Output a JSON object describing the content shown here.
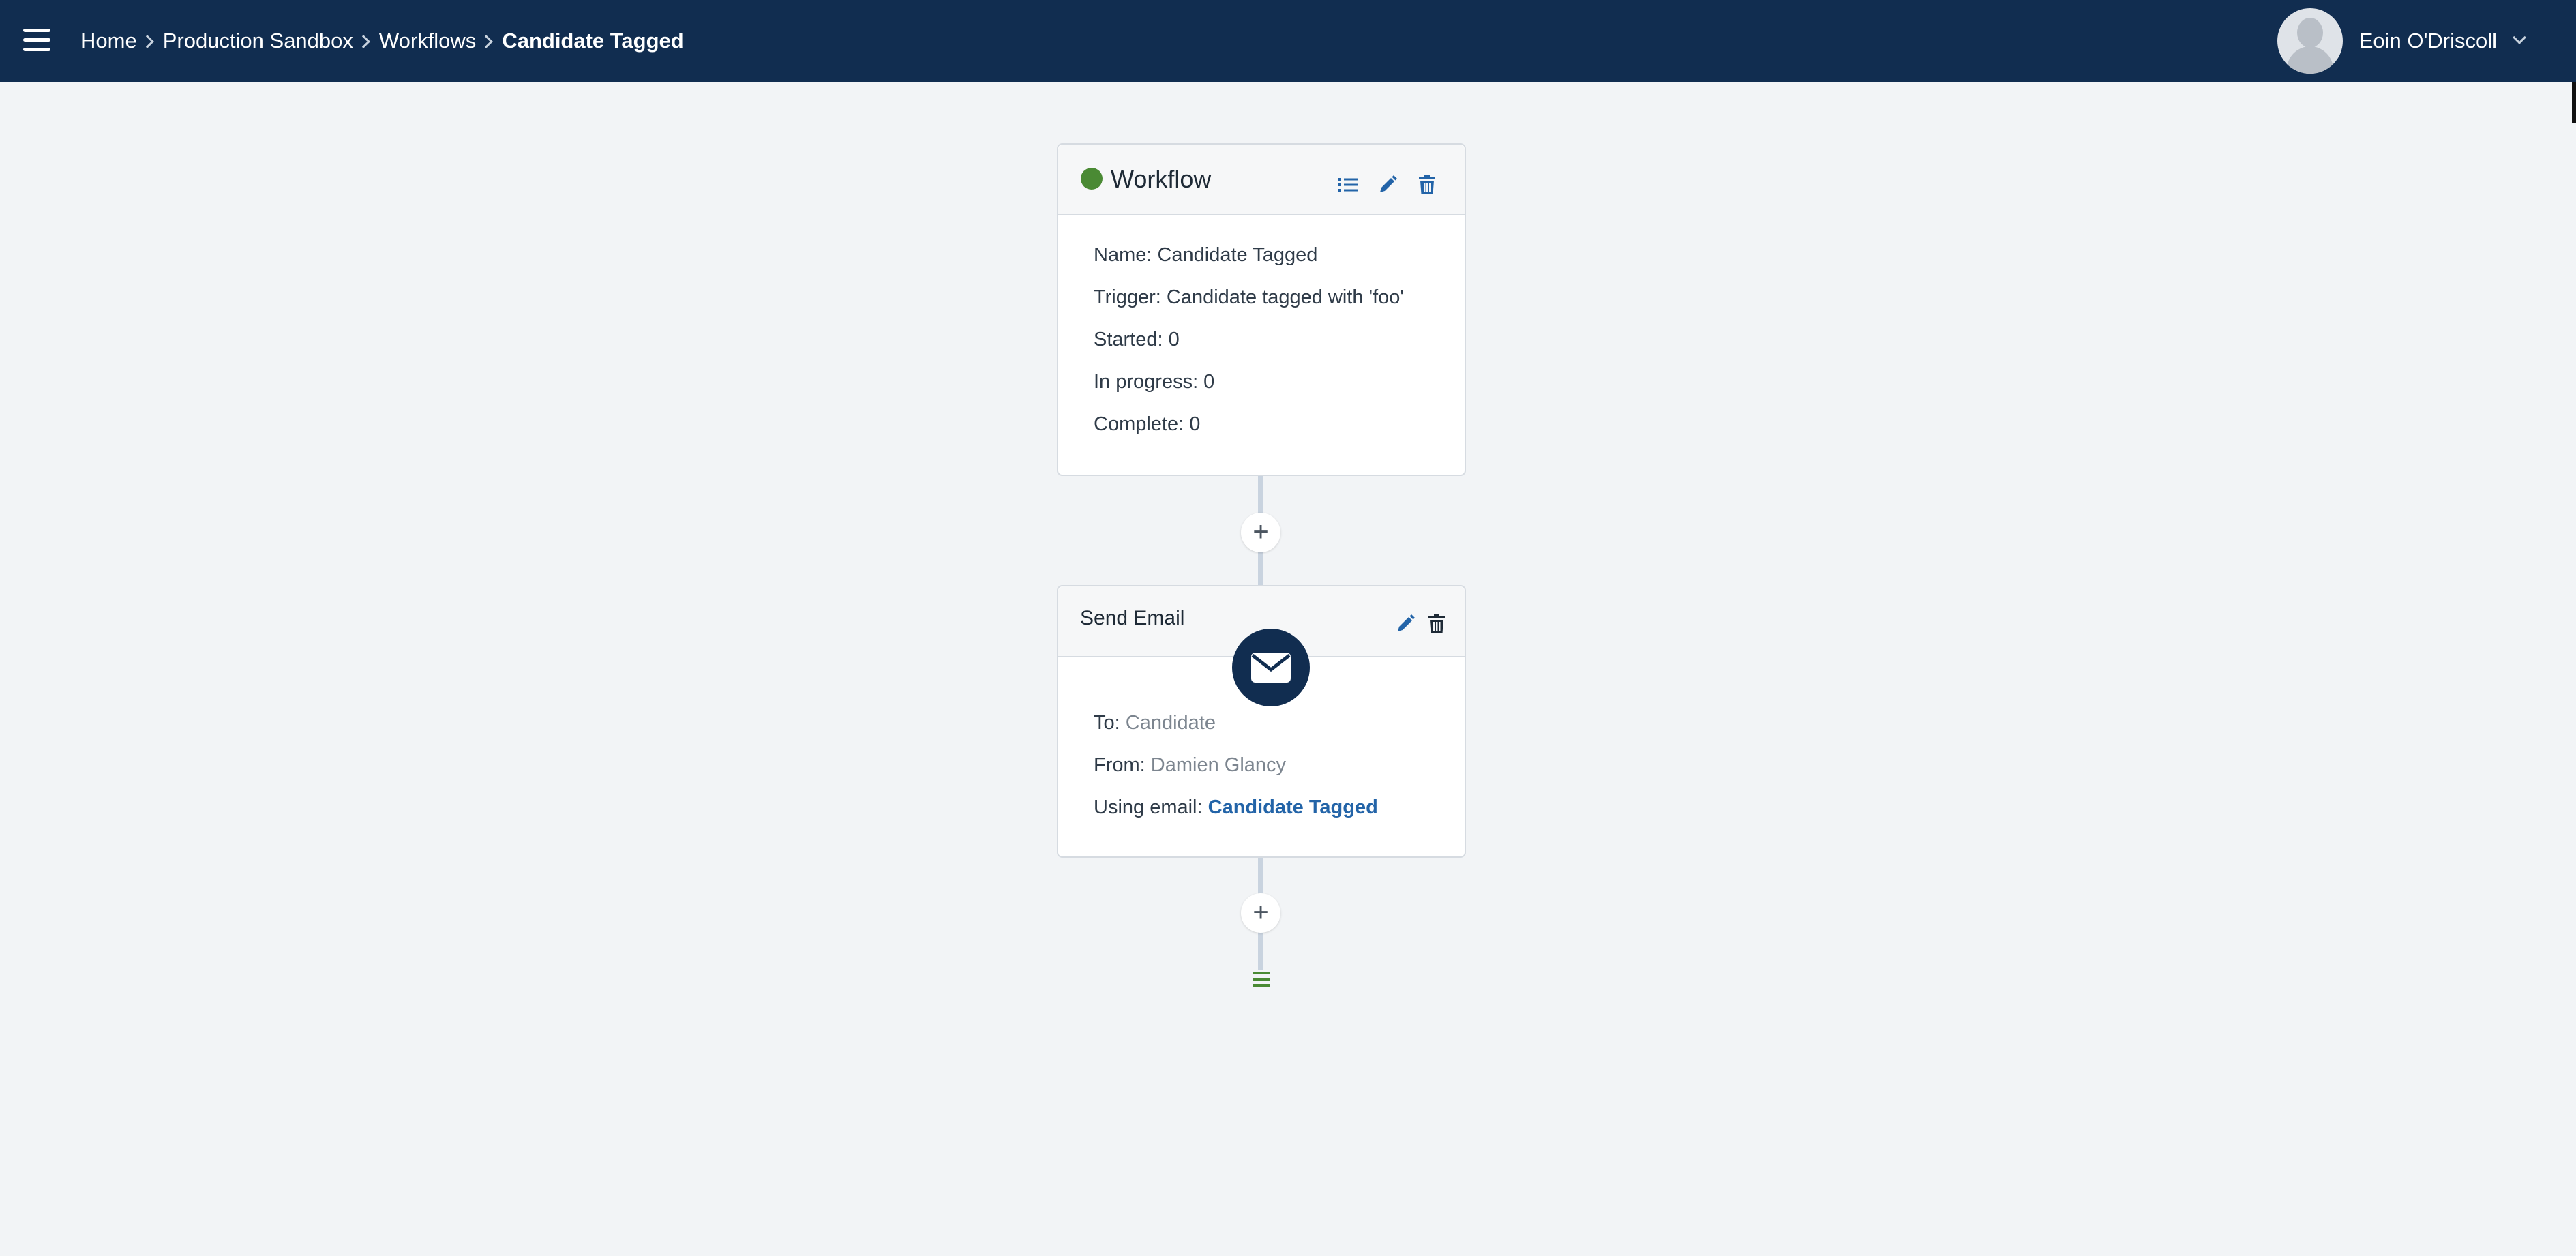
{
  "breadcrumb": {
    "items": [
      "Home",
      "Production Sandbox",
      "Workflows"
    ],
    "current": "Candidate Tagged"
  },
  "user": {
    "name": "Eoin O'Driscoll"
  },
  "workflow_card": {
    "title": "Workflow",
    "status_color": "#4a8a34",
    "rows": [
      "Name: Candidate Tagged",
      "Trigger: Candidate tagged with 'foo'",
      "Started: 0",
      "In progress: 0",
      "Complete: 0"
    ]
  },
  "email_card": {
    "title": "Send Email",
    "to_label": "To:",
    "to_value": "Candidate",
    "from_label": "From:",
    "from_value": "Damien Glancy",
    "using_label": "Using email:",
    "using_value": "Candidate Tagged"
  },
  "add_step": {
    "symbol": "+"
  },
  "colors": {
    "topbar": "#112d50",
    "accent": "#2364a8",
    "status_active": "#4a8a34"
  },
  "icons": {
    "menu": "hamburger-icon",
    "list": "list-icon",
    "edit": "pencil-icon",
    "delete": "trash-icon",
    "email": "envelope-icon",
    "end": "end-lines-icon"
  }
}
